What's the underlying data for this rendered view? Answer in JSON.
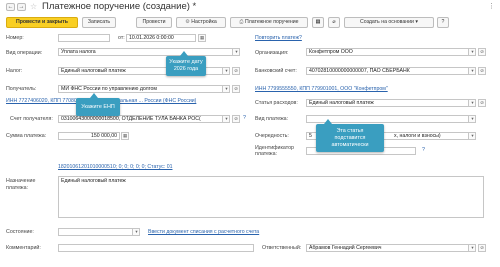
{
  "window": {
    "title": "Платежное поручение (создание) *"
  },
  "toolbar": {
    "post_close": "Провести и закрыть",
    "save": "Записать",
    "post": "Провести",
    "settings": "Настройка",
    "payment_order": "Платежное поручение",
    "create_based_on": "Создать на основании"
  },
  "form": {
    "number_label": "Номер:",
    "number_value": "",
    "from_label": "от:",
    "date_value": "10.01.2026 0:00:00",
    "repeat_link": "Повторить платеж?",
    "op_type_label": "Вид операции:",
    "op_type_value": "Уплата налога",
    "org_label": "Организация:",
    "org_value": "Конфетпром ООО",
    "tax_label": "Налог:",
    "tax_value": "Единый налоговый платеж",
    "bank_acc_label": "Банковский счет:",
    "bank_acc_value": "40702810000000000007, ПАО СБЕРБАНК",
    "recipient_label": "Получатель:",
    "recipient_value": "МИ ФНС России по управлению долгом",
    "inn_link_left": "ИНН 7727406020, КПП 770801001, \"Межрегиональная ... России (ФНС России)",
    "inn_link_right": "ИНН 7799555550, КПП 779901001, ООО \"Конфетпром\"",
    "expense_label": "Статья расходов:",
    "expense_value": "Единый налоговый платеж",
    "recipient_acc_label": "Счет получателя:",
    "recipient_acc_value": "03100643000000018500, ОТДЕЛЕНИЕ ТУЛА БАНКА РОС(",
    "payment_type_label": "Вид платежа:",
    "payment_type_value": "",
    "sum_label": "Сумма платежа:",
    "sum_value": "150 000,00",
    "priority_label": "Очередность:",
    "priority_value": "5",
    "priority_tail": "х, налоги и взносы)",
    "identifier_label": "Идентификатор платежа:",
    "kbk_link": "18201061201010000510; 0; 0; 0; 0; 0; Статус: 01",
    "purpose_label": "Назначение платежа:",
    "purpose_value": "Единый налоговый платеж",
    "state_label": "Состояние:",
    "state_value": "",
    "write_off_link": "Ввести документ списания с расчетного счета",
    "comment_label": "Комментарий:",
    "comment_value": "",
    "responsible_label": "Ответственный:",
    "responsible_value": "Абрамов Геннадий Сергеевич"
  },
  "hints": {
    "date_hint": "Укажите дату 2026 года",
    "ens_hint": "Укажите ЕНП",
    "auto_hint": "Эта статья подставится автоматически"
  },
  "glyphs": {
    "back": "←",
    "forward": "→",
    "star": "☆",
    "dropdown": "▾",
    "link": "⊘",
    "calendar": "▦",
    "question": "?",
    "more": "⋮"
  },
  "colors": {
    "accent": "#f9cf23",
    "hint": "#3a9ec0",
    "link": "#2a63ad"
  }
}
